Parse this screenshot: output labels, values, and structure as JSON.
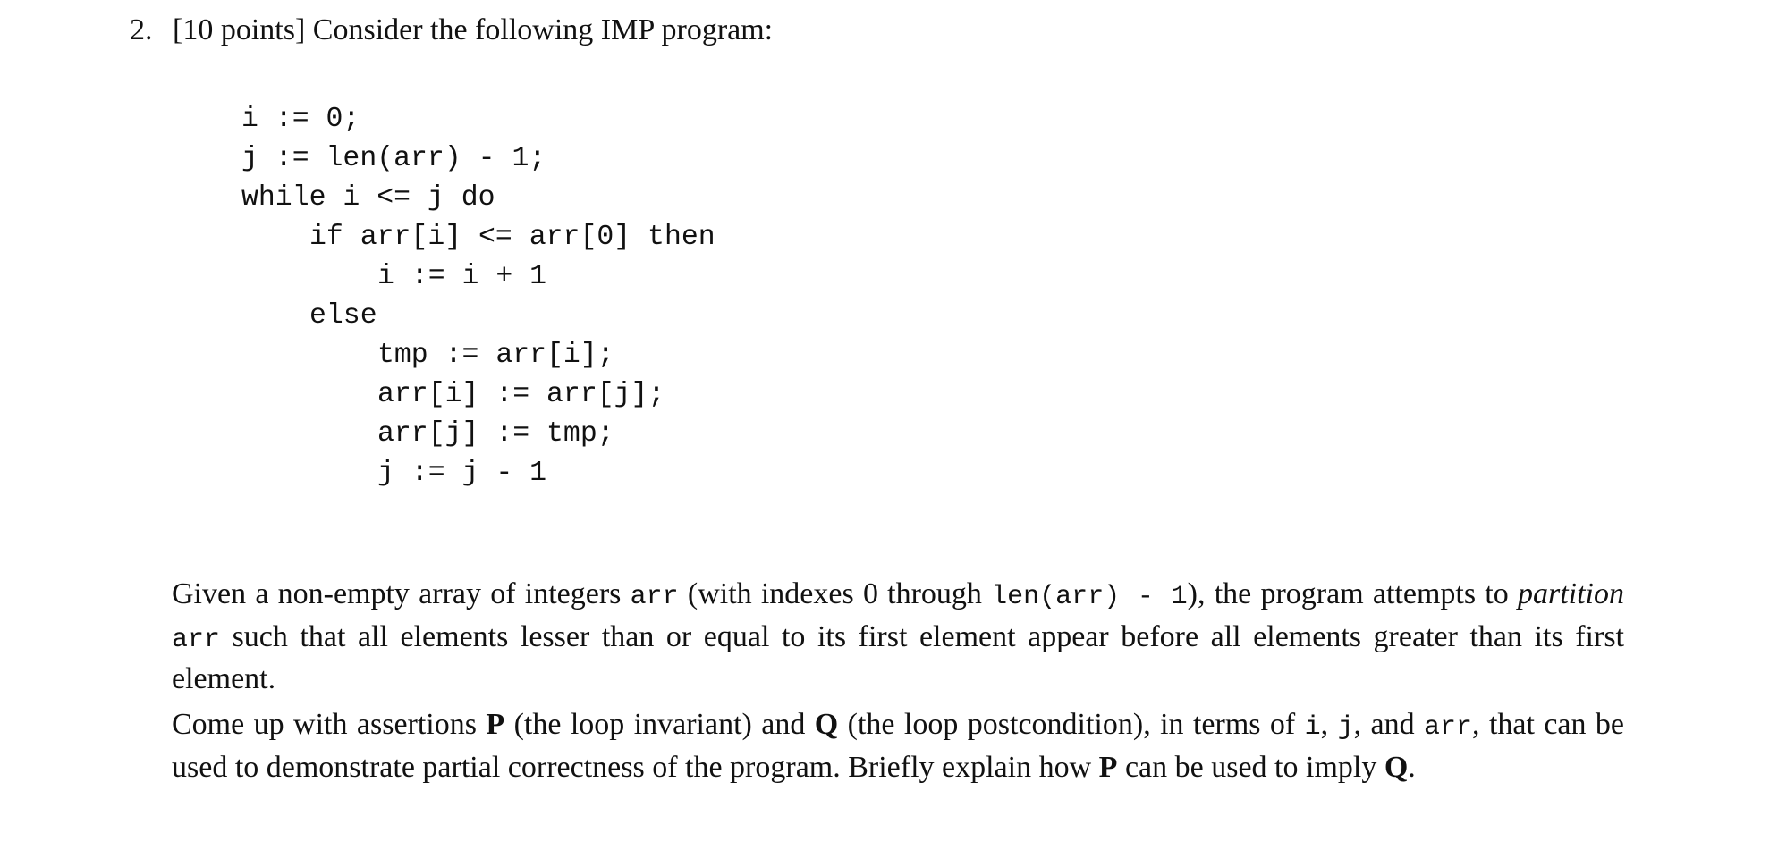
{
  "question": {
    "number": "2.",
    "points": "[10 points]",
    "prompt": "Consider the following IMP program:"
  },
  "code": [
    {
      "indent": 0,
      "text": "i := 0;"
    },
    {
      "indent": 0,
      "text": "j := len(arr) - 1;"
    },
    {
      "indent": 0,
      "text": "while i <= j do"
    },
    {
      "indent": 1,
      "text": "if arr[i] <= arr[0] then"
    },
    {
      "indent": 2,
      "text": "i := i + 1"
    },
    {
      "indent": 1,
      "text": "else"
    },
    {
      "indent": 2,
      "text": "tmp := arr[i];"
    },
    {
      "indent": 2,
      "text": "arr[i] := arr[j];"
    },
    {
      "indent": 2,
      "text": "arr[j] := tmp;"
    },
    {
      "indent": 2,
      "text": "j := j - 1"
    }
  ],
  "paragraph1": {
    "t1": "Given a non-empty array of integers ",
    "c1": "arr",
    "t2": " (with indexes 0 through ",
    "c2": "len(arr) - 1",
    "t3": "), the program attempts to ",
    "em1": "partition",
    "t4": " ",
    "c3": "arr",
    "t5": " such that all elements lesser than or equal to its first element appear before all elements greater than its first element."
  },
  "paragraph2": {
    "t1": "Come up with assertions ",
    "b1": "P",
    "t2": " (the loop invariant) and ",
    "b2": "Q",
    "t3": " (the loop postcondition), in terms of ",
    "c1": "i",
    "t4": ", ",
    "c2": "j",
    "t5": ", and ",
    "c3": "arr",
    "t6": ", that can be used to demonstrate partial correctness of the program. Briefly explain how ",
    "b3": "P",
    "t7": " can be used to imply ",
    "b4": "Q",
    "t8": "."
  }
}
